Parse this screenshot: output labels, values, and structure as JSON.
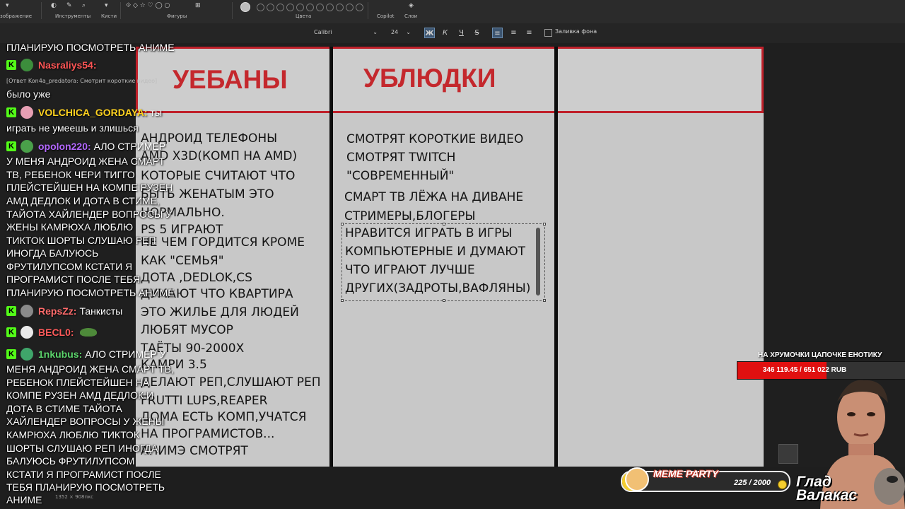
{
  "ribbon": {
    "groups": [
      "зображение",
      "Инструменты",
      "Кисти",
      "Фигуры",
      "Цвета",
      "Copilot",
      "Слои"
    ]
  },
  "format_bar": {
    "font": "Calibri",
    "size": "24",
    "bold": "Ж",
    "italic": "К",
    "underline": "Ч",
    "strike": "S",
    "fill_label": "Заливка фона"
  },
  "table": {
    "col1_header": "УЕБАНЫ",
    "col2_header": "УБЛЮДКИ",
    "col3_header": "",
    "col1_lines": [
      "АНДРОИД ТЕЛЕФОНЫ",
      "AMD X3D(КОМП НА AMD)",
      "КОТОРЫЕ СЧИТАЮТ ЧТО",
      "БЫТЬ ЖЕНАТЫМ ЭТО",
      "НОРМАЛЬНО.",
      "PS 5 ИГРАЮТ",
      "НЕ ЧЕМ ГОРДИТСЯ КРОМЕ",
      "КАК \"СЕМЬЯ\"",
      "ДОТА ,DEDLOK,CS",
      "ДУМАЮТ ЧТО КВАРТИРА",
      "ЭТО ЖИЛЬЕ ДЛЯ ЛЮДЕЙ",
      "ЛЮБЯТ МУСОР",
      "ТАЁТЫ 90-2000Х",
      "КАМРИ 3.5",
      "ДЕЛАЮТ РЕП,СЛУШАЮТ РЕП",
      "FRUTTI LUPS,REAPER",
      "ДОМА ЕСТЬ КОМП,УЧАТСЯ",
      "НА ПРОГРАМИСТОВ...",
      "АНИМЭ СМОТРЯТ"
    ],
    "col2_lines": [
      "СМОТРЯТ КОРОТКИЕ ВИДЕО",
      "СМОТРЯТ TWITCH",
      "\"СОВРЕМЕННЫЙ\"",
      "СМАРТ ТВ ЛЁЖА НА ДИВАНЕ",
      "СТРИМЕРЫ,БЛОГЕРЫ",
      "НРАВИТСЯ ИГРАТЬ В ИГРЫ",
      "КОМПЬЮТЕРНЫЕ И ДУМАЮТ",
      "ЧТО ИГРАЮТ ЛУЧШЕ",
      "ДРУГИХ(ЗАДРОТЫ,ВАФЛЯНЫ)"
    ]
  },
  "status": {
    "canvas_size": "1352 × 908пкс"
  },
  "chat": {
    "line1": "ПЛАНИРУЮ ПОСМОТРЕТЬ АНИМЕ",
    "user1": "Nasraliys54:",
    "user1_color": "#ff5555",
    "reply1": "[Ответ Kon4a_predatora: Смотрит короткие видео]",
    "line2": "было уже",
    "user2": "VOLCHICA_GORDAYA:",
    "user2_color": "#ffd21f",
    "user2_msg": "ты",
    "line3": "играть не умеешь и злишься",
    "user3": "opolon220:",
    "user3_color": "#b368ff",
    "user3_msg": "АЛО СТРИМЕР",
    "block1": [
      "У МЕНЯ АНДРОИД ЖЕНА СМАРТ",
      "ТВ, РЕБЕНОК ЧЕРИ ТИГГО",
      "ПЛЕЙСТЕЙШЕН НА КОМПЕ РУЗЕН",
      "АМД ДЕДЛОК И ДОТА В СТИМЕ,",
      "ТАЙОТА ХАЙЛЕНДЕР ВОПРОСЫ У",
      "ЖЕНЫ КАМРЮХА ЛЮБЛЮ",
      "ТИКТОК ШОРТЫ СЛУШАЮ РЕП",
      "ИНОГДА БАЛУЮСЬ",
      "ФРУТИЛУПСОМ КСТАТИ Я",
      "ПРОГРАМИСТ ПОСЛЕ ТЕБЯ",
      "ПЛАНИРУЮ ПОСМОТРЕТЬ АНИМЕ"
    ],
    "user4": "RepsZz:",
    "user4_color": "#ff6b6b",
    "user4_msg": "Танкисты",
    "user5": "BECL0:",
    "user5_color": "#ff5a5a",
    "user6": "1nkubus:",
    "user6_color": "#5bd36b",
    "user6_msg": "АЛО СТРИМЕР У",
    "block2": [
      "МЕНЯ АНДРОИД ЖЕНА СМАРТ ТВ,",
      "РЕБЕНОК ПЛЕЙСТЕЙШЕН НА",
      "КОМПЕ РУЗЕН АМД ДЕДЛОК И",
      "ДОТА В СТИМЕ ТАЙОТА",
      "ХАЙЛЕНДЕР ВОПРОСЫ У ЖЕНЫ",
      "КАМРЮХА ЛЮБЛЮ ТИКТОК",
      "ШОРТЫ СЛУШАЮ РЕП ИНОГДА",
      "БАЛУЮСЬ ФРУТИЛУПСОМ",
      "КСТАТИ Я ПРОГРАМИСТ ПОСЛЕ",
      "ТЕБЯ ПЛАНИРУЮ ПОСМОТРЕТЬ",
      "АНИМЕ"
    ]
  },
  "goal": {
    "title": "НА ХРУМОЧКИ ЦАПОЧКЕ ЕНОТИКУ",
    "progress_text": "346 119.45 / 651 022 RUB",
    "progress": 0.53
  },
  "meme": {
    "title": "MEME PARTY",
    "count": "225 / 2000",
    "progress": 0.11
  },
  "streamer": {
    "line1": "Глад",
    "line2": "Валакас"
  }
}
